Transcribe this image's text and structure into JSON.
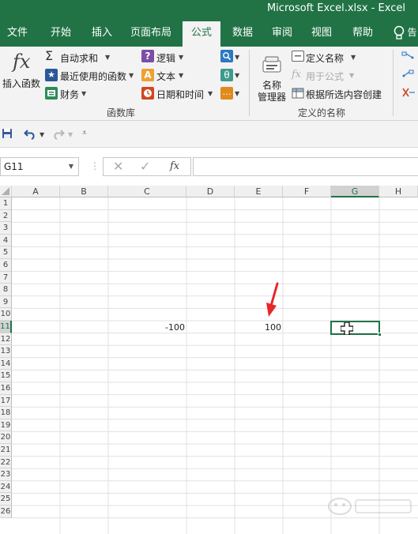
{
  "window": {
    "title": "Microsoft Excel.xlsx  -  Excel"
  },
  "tabs": [
    "文件",
    "开始",
    "插入",
    "页面布局",
    "公式",
    "数据",
    "审阅",
    "视图",
    "帮助"
  ],
  "active_tab": "公式",
  "ribbon": {
    "insert_function": "插入函数",
    "autosum": "自动求和",
    "recently_used": "最近使用的函数",
    "financial": "财务",
    "logical": "逻辑",
    "text": "文本",
    "datetime": "日期和时间",
    "function_library_label": "函数库",
    "name_manager_line1": "名称",
    "name_manager_line2": "管理器",
    "define_name": "定义名称",
    "use_in_formula": "用于公式",
    "create_from_selection": "根据所选内容创建",
    "defined_names_label": "定义的名称"
  },
  "formula_bar": {
    "name_box": "G11",
    "formula": ""
  },
  "columns": [
    "A",
    "B",
    "C",
    "D",
    "E",
    "F",
    "G",
    "H"
  ],
  "selected_column": "G",
  "rows": [
    "1",
    "2",
    "3",
    "4",
    "5",
    "6",
    "7",
    "8",
    "9",
    "10",
    "11",
    "12",
    "13",
    "14",
    "15",
    "16",
    "17",
    "18",
    "19",
    "20",
    "21",
    "22",
    "23",
    "24",
    "25",
    "26"
  ],
  "selected_row": "11",
  "cells": {
    "C11": "-100",
    "E11": "100"
  },
  "colors": {
    "accent": "#217346",
    "arrow": "#e8262b"
  }
}
